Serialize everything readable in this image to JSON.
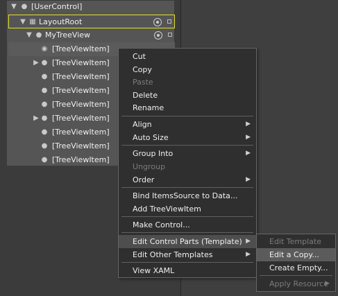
{
  "tree": {
    "user_control": "[UserControl]",
    "layout_root": "LayoutRoot",
    "my_tree_view": "MyTreeView",
    "items": [
      "[TreeViewItem]",
      "[TreeViewItem]",
      "[TreeViewItem]",
      "[TreeViewItem]",
      "[TreeViewItem]",
      "[TreeViewItem]",
      "[TreeViewItem]",
      "[TreeViewItem]",
      "[TreeViewItem]"
    ]
  },
  "menu": {
    "cut": "Cut",
    "copy": "Copy",
    "paste": "Paste",
    "delete": "Delete",
    "rename": "Rename",
    "align": "Align",
    "auto_size": "Auto Size",
    "group_into": "Group Into",
    "ungroup": "Ungroup",
    "order": "Order",
    "bind_items_source": "Bind ItemsSource to Data...",
    "add_tree_view_item": "Add TreeViewItem",
    "make_control": "Make Control...",
    "edit_control_parts": "Edit Control Parts (Template)",
    "edit_other_templates": "Edit Other Templates",
    "view_xaml": "View XAML"
  },
  "submenu": {
    "edit_template": "Edit Template",
    "edit_a_copy": "Edit a Copy...",
    "create_empty": "Create Empty...",
    "apply_resource": "Apply Resource"
  },
  "icons": {
    "expand": "triangle-icon",
    "visibility": "eye-icon",
    "lock": "lock-icon",
    "submenu": "chevron-right-icon"
  }
}
